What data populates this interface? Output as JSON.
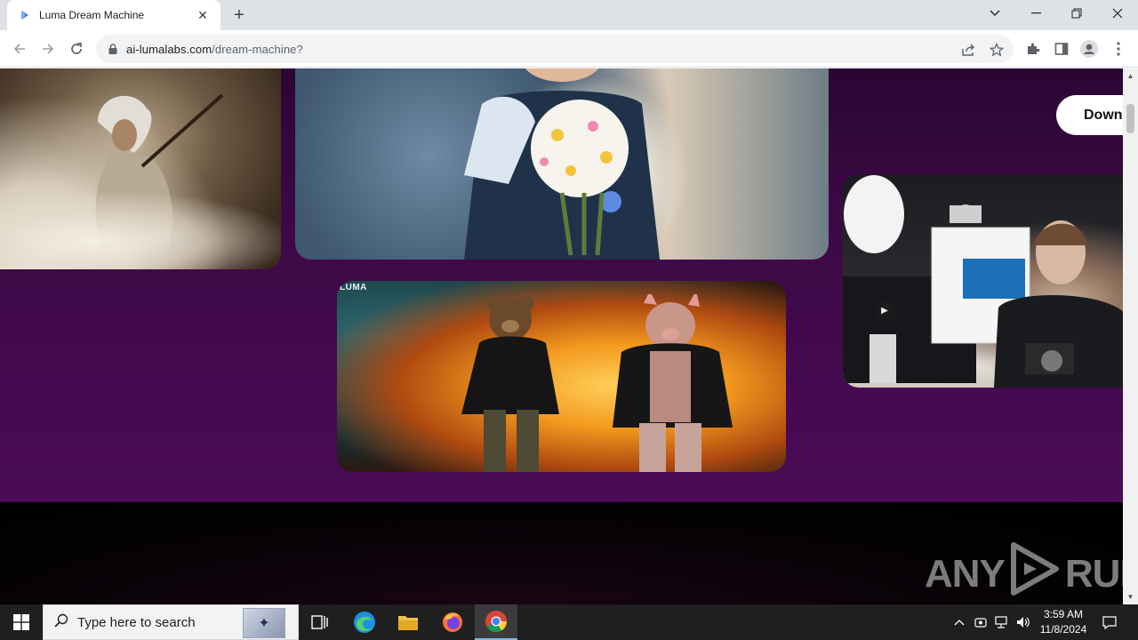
{
  "browser": {
    "tab": {
      "title": "Luma Dream Machine"
    },
    "url": {
      "domain": "ai-lumalabs.com",
      "path": "/dream-machine?"
    }
  },
  "page": {
    "download_button_label": "Down",
    "bears_card_watermark": "LUMA",
    "colors": {
      "purple": "#4a0b57",
      "dark": "#050205"
    }
  },
  "overlay": {
    "anyrun_left": "ANY",
    "anyrun_right": "RUN"
  },
  "taskbar": {
    "search_placeholder": "Type here to search",
    "clock_time": "3:59 AM",
    "clock_date": "11/8/2024"
  }
}
